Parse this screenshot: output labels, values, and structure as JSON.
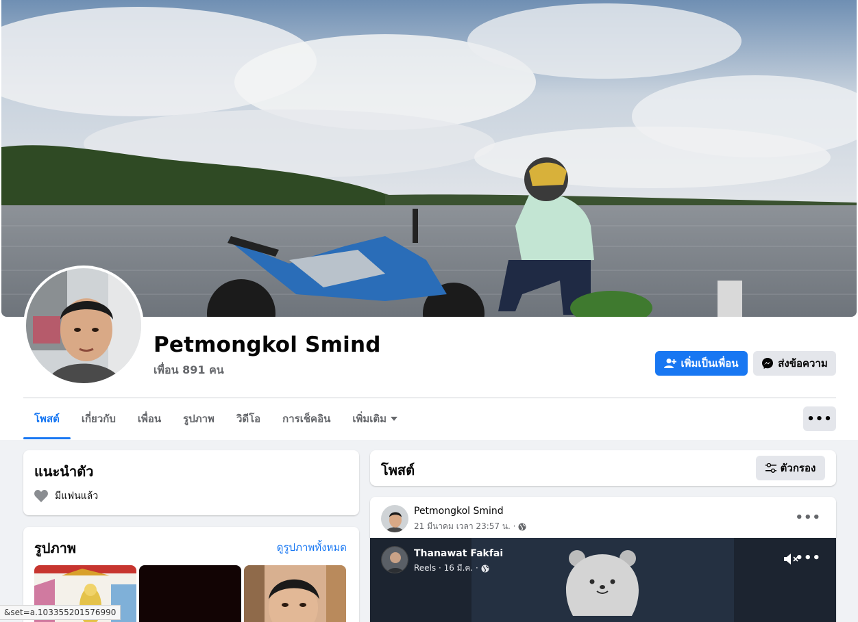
{
  "profile": {
    "name": "Petmongkol Smind",
    "friends": "เพื่อน 891 คน",
    "add_friend_label": "เพิ่มเป็นเพื่อน",
    "message_label": "ส่งข้อความ"
  },
  "tabs": [
    {
      "label": "โพสต์",
      "active": true
    },
    {
      "label": "เกี่ยวกับ"
    },
    {
      "label": "เพื่อน"
    },
    {
      "label": "รูปภาพ"
    },
    {
      "label": "วิดีโอ"
    },
    {
      "label": "การเช็คอิน"
    },
    {
      "label": "เพิ่มเติม"
    }
  ],
  "more_label": "•••",
  "intro": {
    "title": "แนะนำตัว",
    "relationship": "มีแฟนแล้ว"
  },
  "photos": {
    "title": "รูปภาพ",
    "see_all": "ดูรูปภาพทั้งหมด"
  },
  "posts": {
    "title": "โพสต์",
    "filter_label": "ตัวกรอง"
  },
  "post": {
    "author": "Petmongkol Smind",
    "meta": "21 มีนาคม เวลา 23:57 น. ·",
    "dots": "•••",
    "reel": {
      "author": "Thanawat Fakfai",
      "meta": "Reels · 16 มี.ค. ·",
      "dots": "•••"
    }
  },
  "status_bar": "&set=a.103355201576990",
  "colors": {
    "accent": "#1877f2",
    "page_bg": "#f0f2f5",
    "secondary_text": "#65676b"
  }
}
